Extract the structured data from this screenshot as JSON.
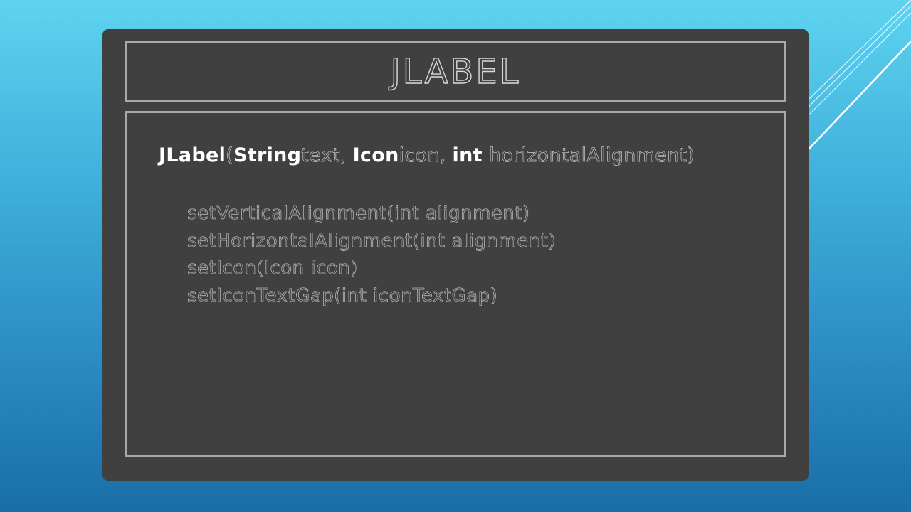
{
  "slide": {
    "title": "JLABEL",
    "constructor": {
      "name": "JLabel",
      "open_paren": "(",
      "type1": "String",
      "param1": "text, ",
      "type2": "Icon",
      "param2": "icon, ",
      "type3": "int",
      "param3": " horizontalAlignment)"
    },
    "methods": [
      "setVerticalAlignment(int alignment)",
      "setHorizontalAlignment(int alignment)",
      "setIcon(Icon icon)",
      "setIconTextGap(int iconTextGap)"
    ]
  },
  "colors": {
    "background_top": "#5fd3ef",
    "background_bottom": "#1a6ea8",
    "board": "#404040",
    "frame": "#a9a9a9",
    "keyword": "#ffffff",
    "chalk_text": "#b5b5b5"
  }
}
